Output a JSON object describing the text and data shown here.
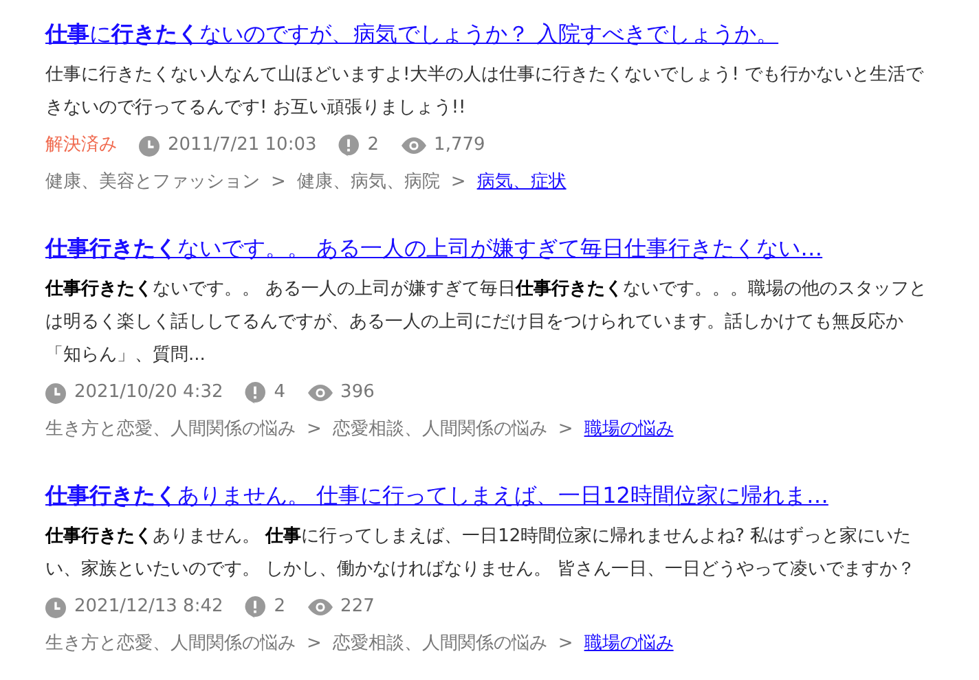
{
  "results": [
    {
      "title": "**仕事**に**行きたく**ないのですが、病気でしょうか？ 入院すべきでしょうか。",
      "snippet": "仕事に行きたくない人なんて山ほどいますよ!大半の人は仕事に行きたくないでしょう! でも行かないと生活できないので行ってるんです! お互い頑張りましょう!!",
      "meta": [
        {
          "kind": "status",
          "text": "解決済み"
        },
        {
          "kind": "date",
          "text": "2011/7/21 10:03"
        },
        {
          "kind": "answers",
          "text": "2"
        },
        {
          "kind": "views",
          "text": "1,779"
        }
      ],
      "separator": ">",
      "crumbs": [
        {
          "text": "健康、美容とファッション",
          "link": false
        },
        {
          "text": "健康、病気、病院",
          "link": false
        },
        {
          "text": "病気、症状",
          "link": true
        }
      ]
    },
    {
      "title": "**仕事行きたく**ないです。。 ある一人の上司が嫌すぎて毎日仕事行きたくない…",
      "snippet": "**仕事行きたく**ないです。。 ある一人の上司が嫌すぎて毎日**仕事行きたく**ないです。。。職場の他のスタッフとは明るく楽しく話ししてるんですが、ある一人の上司にだけ目をつけられています。話しかけても無反応か「知らん」、質問...",
      "meta": [
        {
          "kind": "date",
          "text": "2021/10/20 4:32"
        },
        {
          "kind": "answers",
          "text": "4"
        },
        {
          "kind": "views",
          "text": "396"
        }
      ],
      "separator": ">",
      "crumbs": [
        {
          "text": "生き方と恋愛、人間関係の悩み",
          "link": false
        },
        {
          "text": "恋愛相談、人間関係の悩み",
          "link": false
        },
        {
          "text": "職場の悩み",
          "link": true
        }
      ]
    },
    {
      "title": "**仕事行きたく**ありません。 仕事に行ってしまえば、一日12時間位家に帰れま…",
      "snippet": "**仕事行きたく**ありません。 **仕事**に行ってしまえば、一日12時間位家に帰れませんよね? 私はずっと家にいたい、家族といたいのです。 しかし、働かなければなりません。 皆さん一日、一日どうやって凌いでますか？",
      "meta": [
        {
          "kind": "date",
          "text": "2021/12/13 8:42"
        },
        {
          "kind": "answers",
          "text": "2"
        },
        {
          "kind": "views",
          "text": "227"
        }
      ],
      "separator": ">",
      "crumbs": [
        {
          "text": "生き方と恋愛、人間関係の悩み",
          "link": false
        },
        {
          "text": "恋愛相談、人間関係の悩み",
          "link": false
        },
        {
          "text": "職場の悩み",
          "link": true
        }
      ]
    }
  ]
}
